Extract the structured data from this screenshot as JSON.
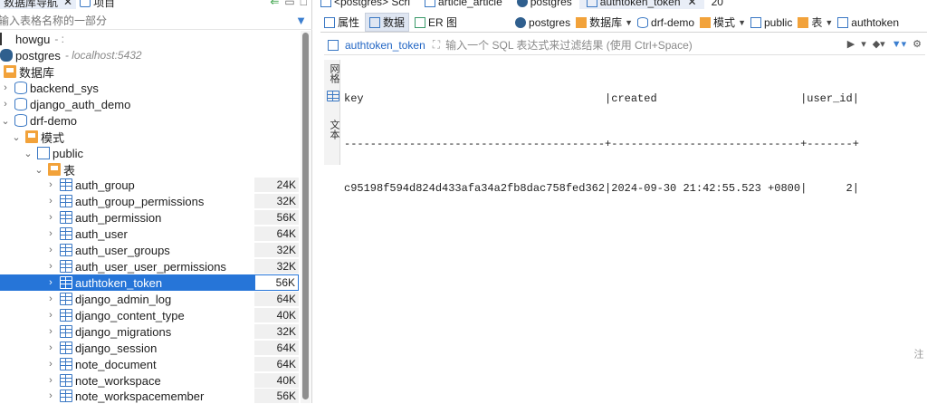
{
  "nav": {
    "tab_db_nav": "数据库导航",
    "tab_project": "项目",
    "filter_placeholder": "输入表格名称的一部分"
  },
  "tree": {
    "user_node": "howgu",
    "user_suffix": "- :",
    "connection": "postgres",
    "connection_host": "- localhost:5432",
    "databases_folder": "数据库",
    "databases": [
      "backend_sys",
      "django_auth_demo",
      "drf-demo"
    ],
    "schemas_folder": "模式",
    "schema": "public",
    "tables_folder": "表",
    "tables": [
      {
        "name": "auth_group",
        "size": "24K"
      },
      {
        "name": "auth_group_permissions",
        "size": "32K"
      },
      {
        "name": "auth_permission",
        "size": "56K"
      },
      {
        "name": "auth_user",
        "size": "64K"
      },
      {
        "name": "auth_user_groups",
        "size": "32K"
      },
      {
        "name": "auth_user_user_permissions",
        "size": "32K"
      },
      {
        "name": "authtoken_token",
        "size": "56K"
      },
      {
        "name": "django_admin_log",
        "size": "64K"
      },
      {
        "name": "django_content_type",
        "size": "40K"
      },
      {
        "name": "django_migrations",
        "size": "32K"
      },
      {
        "name": "django_session",
        "size": "64K"
      },
      {
        "name": "note_document",
        "size": "64K"
      },
      {
        "name": "note_workspace",
        "size": "40K"
      },
      {
        "name": "note_workspacemember",
        "size": "56K"
      }
    ],
    "selected_table": "authtoken_token"
  },
  "editor_tabs": [
    {
      "label": "<postgres> Scri"
    },
    {
      "label": "article_article"
    },
    {
      "label": "postgres"
    },
    {
      "label": "authtoken_token",
      "close": "✕"
    },
    {
      "label": "20"
    }
  ],
  "sub_tabs": {
    "properties": "属性",
    "data": "数据",
    "er": "ER 图"
  },
  "breadcrumbs": [
    "postgres",
    "数据库",
    "drf-demo",
    "模式",
    "public",
    "表",
    "authtoken"
  ],
  "filter": {
    "table_name": "authtoken_token",
    "placeholder": "输入一个 SQL 表达式来过滤结果 (使用 Ctrl+Space)"
  },
  "side_tabs": {
    "grid": "网格",
    "text": "文本"
  },
  "result": {
    "header_line": "key                                     |created                      |user_id|",
    "separator_line": "----------------------------------------+-----------------------------+-------+",
    "rows": [
      "c95198f594d824d433afa34a2fb8dac758fed362|2024-09-30 21:42:55.523 +0800|      2|"
    ]
  },
  "edge_text": "注"
}
